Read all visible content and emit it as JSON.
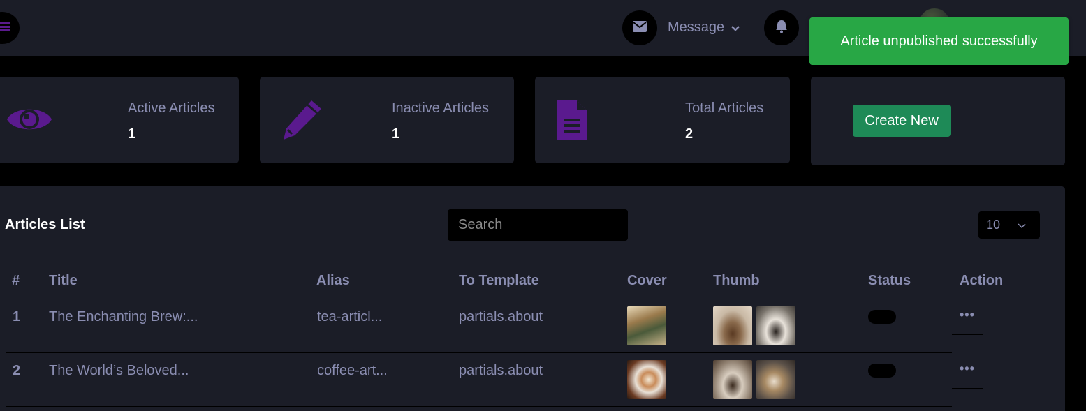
{
  "header": {
    "message_label": "Message",
    "toast": "Article unpublished successfully",
    "colors": {
      "accent": "#5a1a8e",
      "toast": "#28a745"
    }
  },
  "stats": [
    {
      "label": "Active Articles",
      "value": "1",
      "icon": "eye-icon"
    },
    {
      "label": "Inactive Articles",
      "value": "1",
      "icon": "pencil-icon"
    },
    {
      "label": "Total Articles",
      "value": "2",
      "icon": "file-icon"
    }
  ],
  "create_button": "Create New",
  "list": {
    "title": "Articles List",
    "search_placeholder": "Search",
    "page_size": "10",
    "columns": [
      "#",
      "Title",
      "Alias",
      "To Template",
      "Cover",
      "Thumb",
      "Status",
      "Action"
    ],
    "rows": [
      {
        "index": "1",
        "title": "The Enchanting Brew:...",
        "alias": "tea-articl...",
        "template": "partials.about",
        "action": "•••"
      },
      {
        "index": "2",
        "title": "The World’s Beloved...",
        "alias": "coffee-art...",
        "template": "partials.about",
        "action": "•••"
      }
    ]
  }
}
